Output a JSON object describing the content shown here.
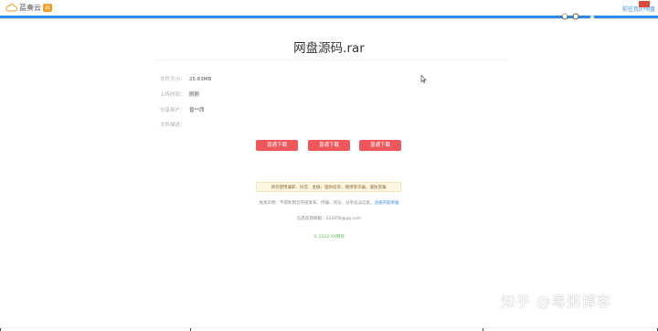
{
  "header": {
    "logo_text": "蓝奏云",
    "logo_badge": "云",
    "link": "前往我的网盘"
  },
  "file": {
    "title": "网盘源码.rar",
    "info": [
      {
        "label": "文件大小：",
        "value": "25.63MB"
      },
      {
        "label": "上传时间：",
        "value": "刚刚"
      },
      {
        "label": "分享用户：",
        "value": "曾**西"
      },
      {
        "label": "文件描述：",
        "value": ""
      }
    ]
  },
  "buttons": [
    "普通下载",
    "普通下载",
    "普通下载"
  ],
  "tip": "请勿使用兼职、抖音、金融、理财投资、赌博等诈骗，谨防受骗",
  "notice": {
    "text": "免责声明：不得利用云存储发布、传播、浏览、分享违法信息。",
    "link": "违规内容举报"
  },
  "report_email": "信息反馈邮箱：123456@qq.com",
  "copyright": "© 2022 XX网盘",
  "watermark": "知乎 @毒粥博客",
  "colors": {
    "accent_blue": "#2d8ce8",
    "button_red": "#f0575d",
    "close_red": "#d94a3c",
    "copyright_green": "#5cb85c"
  }
}
